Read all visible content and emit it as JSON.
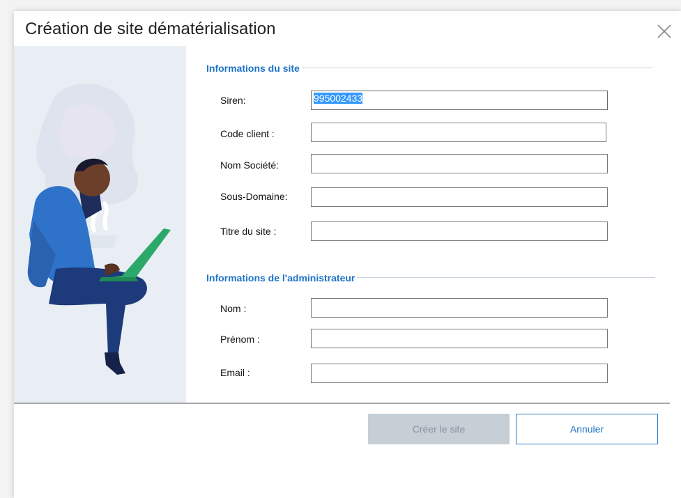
{
  "dialog": {
    "title": "Création de site dématérialisation",
    "close_icon": "close-icon"
  },
  "site_info": {
    "title": "Informations du site",
    "fields": [
      {
        "label": "Siren:",
        "value": "995002433",
        "selected": true
      },
      {
        "label": "Code client :",
        "value": ""
      },
      {
        "label": "Nom Société:",
        "value": ""
      },
      {
        "label": "Sous-Domaine:",
        "value": ""
      },
      {
        "label": "Titre du site :",
        "value": ""
      }
    ]
  },
  "admin_info": {
    "title": "Informations de l'administrateur",
    "fields": [
      {
        "label": "Nom :",
        "value": ""
      },
      {
        "label": "Prénom :",
        "value": ""
      },
      {
        "label": "Email :",
        "value": ""
      }
    ]
  },
  "buttons": {
    "create_label": "Créer le site",
    "create_enabled": false,
    "cancel_label": "Annuler"
  },
  "colors": {
    "accent": "#1e73c8",
    "selection": "#3399ff",
    "disabled_button": "#c6ced6"
  },
  "illustration_icon": "person-with-laptop-illustration"
}
